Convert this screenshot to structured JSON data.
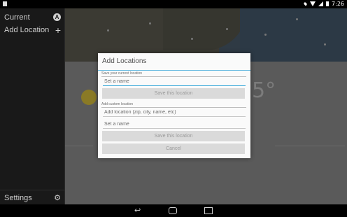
{
  "status_bar": {
    "time": "7:26",
    "icons": [
      "location-icon",
      "wifi-icon",
      "signal-icon",
      "battery-icon"
    ]
  },
  "drawer": {
    "items": [
      {
        "label": "Current",
        "icon": "gps-icon"
      },
      {
        "label": "Add Location",
        "icon": "plus-icon"
      }
    ],
    "settings": {
      "label": "Settings",
      "icon": "gear-icon"
    }
  },
  "background": {
    "temp_peek": "5°"
  },
  "dialog": {
    "title": "Add Locations",
    "current_section_label": "Save your current location",
    "current_name_placeholder": "Set a name",
    "current_save_button": "Save this location",
    "custom_section_label": "Add custom location",
    "custom_location_placeholder": "Add location (zip, city, name, etc)",
    "custom_name_placeholder": "Set a name",
    "custom_save_button": "Save this location",
    "cancel_button": "Cancel"
  },
  "colors": {
    "accent": "#33a6d8",
    "drawer_bg": "#191919",
    "dialog_bg": "#fafafa"
  }
}
